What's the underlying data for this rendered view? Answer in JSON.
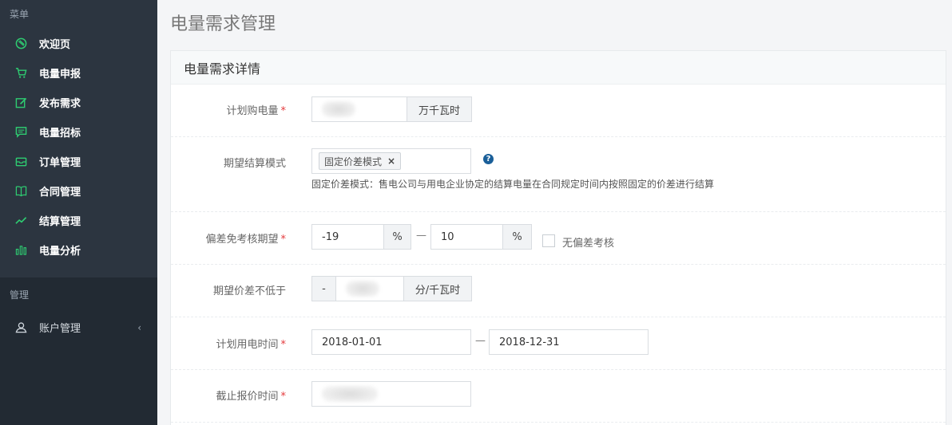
{
  "sidebar": {
    "menu_group_label": "菜单",
    "items": [
      {
        "label": "欢迎页",
        "icon": "welcome-icon"
      },
      {
        "label": "电量申报",
        "icon": "cart-icon"
      },
      {
        "label": "发布需求",
        "icon": "edit-icon"
      },
      {
        "label": "电量招标",
        "icon": "message-icon"
      },
      {
        "label": "订单管理",
        "icon": "envelope-icon"
      },
      {
        "label": "合同管理",
        "icon": "book-icon"
      },
      {
        "label": "结算管理",
        "icon": "trend-icon"
      },
      {
        "label": "电量分析",
        "icon": "bar-chart-icon"
      }
    ],
    "manage_group_label": "管理",
    "manage_items": [
      {
        "label": "账户管理",
        "icon": "user-icon",
        "chevron": "‹"
      }
    ]
  },
  "page": {
    "title": "电量需求管理",
    "panel_title": "电量需求详情"
  },
  "form": {
    "planned_power": {
      "label": "计划购电量",
      "required": "*",
      "unit": "万千瓦时"
    },
    "settlement_mode": {
      "label": "期望结算模式",
      "tag": "固定价差模式",
      "tag_remove": "×",
      "help": "?",
      "hint": "固定价差模式：售电公司与用电企业协定的结算电量在合同规定时间内按照固定的价差进行结算"
    },
    "deviation": {
      "label": "偏差免考核期望",
      "required": "*",
      "min_value": "-19",
      "max_value": "10",
      "unit": "%",
      "separator": "—",
      "no_deviation_label": "无偏差考核"
    },
    "price_diff": {
      "label": "期望价差不低于",
      "prefix": "-",
      "unit": "分/千瓦时"
    },
    "usage_period": {
      "label": "计划用电时间",
      "required": "*",
      "start": "2018-01-01",
      "end": "2018-12-31",
      "separator": "—"
    },
    "deadline": {
      "label": "截止报价时间",
      "required": "*"
    }
  }
}
